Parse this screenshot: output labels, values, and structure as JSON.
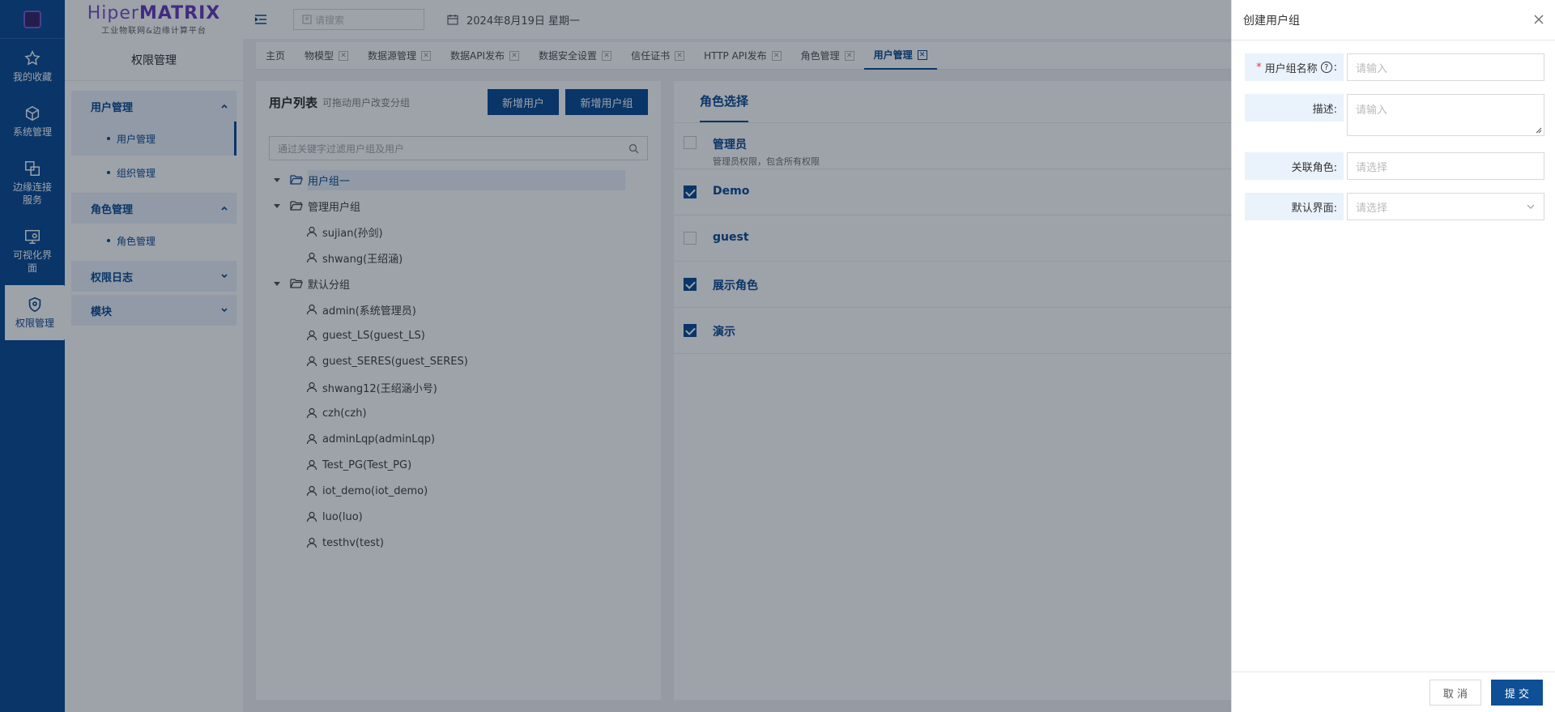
{
  "brand": {
    "name_prefix": "Hiper",
    "name_suffix": "MATRIX",
    "subtitle": "工业物联网&边缘计算平台"
  },
  "rail": [
    {
      "label": "我的收藏",
      "icon": "star-icon"
    },
    {
      "label": "系统管理",
      "icon": "cube-icon"
    },
    {
      "label": "边缘连接服务",
      "icon": "link-icon"
    },
    {
      "label": "可视化界面",
      "icon": "monitor-icon"
    },
    {
      "label": "权限管理",
      "icon": "shield-icon",
      "active": true
    }
  ],
  "sidebar": {
    "title": "权限管理",
    "groups": [
      {
        "label": "用户管理",
        "items": [
          "用户管理",
          "组织管理"
        ]
      },
      {
        "label": "角色管理",
        "items": [
          "角色管理"
        ]
      },
      {
        "label": "权限日志",
        "items": []
      },
      {
        "label": "模块",
        "items": []
      }
    ]
  },
  "topbar": {
    "search_placeholder": "请搜索",
    "date": "2024年8月19日 星期一"
  },
  "tabs": [
    {
      "label": "主页",
      "closable": false
    },
    {
      "label": "物模型",
      "closable": true
    },
    {
      "label": "数据源管理",
      "closable": true
    },
    {
      "label": "数据API发布",
      "closable": true
    },
    {
      "label": "数据安全设置",
      "closable": true
    },
    {
      "label": "信任证书",
      "closable": true
    },
    {
      "label": "HTTP API发布",
      "closable": true
    },
    {
      "label": "角色管理",
      "closable": true
    },
    {
      "label": "用户管理",
      "closable": true,
      "active": true
    }
  ],
  "users_panel": {
    "title": "用户列表",
    "hint": "可拖动用户改变分组",
    "add_user": "新增用户",
    "add_group": "新增用户组",
    "filter_placeholder": "通过关键字过滤用户组及用户",
    "tree": [
      {
        "type": "group",
        "label": "用户组一",
        "expanded": true,
        "selected": true
      },
      {
        "type": "group",
        "label": "管理用户组",
        "expanded": true
      },
      {
        "type": "user",
        "label": "sujian(孙剑)"
      },
      {
        "type": "user",
        "label": "shwang(王绍涵)"
      },
      {
        "type": "group",
        "label": "默认分组",
        "expanded": true
      },
      {
        "type": "user",
        "label": "admin(系统管理员)"
      },
      {
        "type": "user",
        "label": "guest_LS(guest_LS)"
      },
      {
        "type": "user",
        "label": "guest_SERES(guest_SERES)"
      },
      {
        "type": "user",
        "label": "shwang12(王绍涵小号)"
      },
      {
        "type": "user",
        "label": "czh(czh)"
      },
      {
        "type": "user",
        "label": "adminLqp(adminLqp)"
      },
      {
        "type": "user",
        "label": "Test_PG(Test_PG)"
      },
      {
        "type": "user",
        "label": "iot_demo(iot_demo)"
      },
      {
        "type": "user",
        "label": "luo(luo)"
      },
      {
        "type": "user",
        "label": "testhv(test)"
      }
    ]
  },
  "roles_panel": {
    "tab": "角色选择",
    "roles": [
      {
        "name": "管理员",
        "desc": "管理员权限，包含所有权限",
        "checked": false
      },
      {
        "name": "Demo",
        "desc": "",
        "checked": true
      },
      {
        "name": "guest",
        "desc": "",
        "checked": false
      },
      {
        "name": "展示角色",
        "desc": "",
        "checked": true
      },
      {
        "name": "演示",
        "desc": "",
        "checked": true
      }
    ]
  },
  "drawer": {
    "title": "创建用户组",
    "fields": {
      "name_label": "用户组名称",
      "name_placeholder": "请输入",
      "desc_label": "描述:",
      "desc_placeholder": "请输入",
      "role_label": "关联角色:",
      "role_placeholder": "请选择",
      "view_label": "默认界面:",
      "view_placeholder": "请选择"
    },
    "cancel": "取 消",
    "submit": "提 交"
  },
  "colors": {
    "primary": "#0f4f96",
    "accent_light": "#eaf2fb",
    "brand": "#7a58c8",
    "required": "#e53935"
  }
}
